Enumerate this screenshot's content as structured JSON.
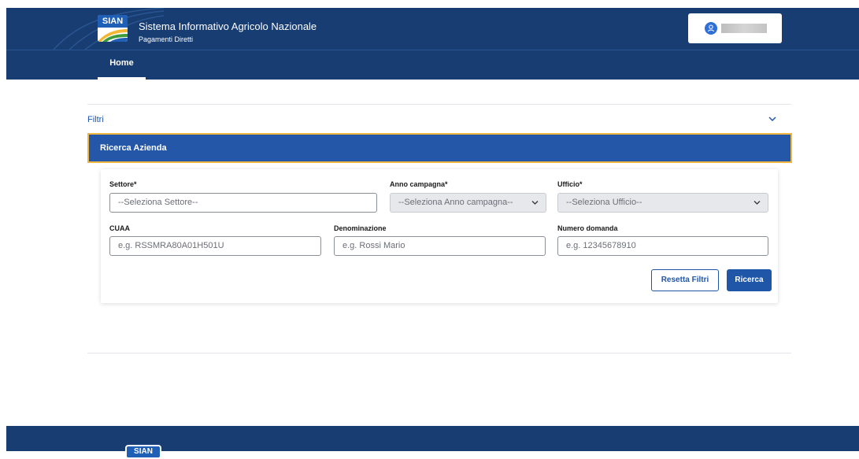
{
  "header": {
    "logo_text": "SIAN",
    "title": "Sistema Informativo Agricolo Nazionale",
    "subtitle": "Pagamenti Diretti",
    "brand_color": "#173d73"
  },
  "user_menu": {
    "icon": "user-icon"
  },
  "nav": {
    "home_label": "Home"
  },
  "filters": {
    "section_label": "Filtri",
    "ricerca_title": "Ricerca Azienda",
    "settore": {
      "label": "Settore*",
      "placeholder": "--Seleziona Settore--"
    },
    "anno_campagna": {
      "label": "Anno campagna*",
      "value": "--Seleziona Anno campagna--"
    },
    "ufficio": {
      "label": "Ufficio*",
      "value": "--Seleziona Ufficio--"
    },
    "cuaa": {
      "label": "CUAA",
      "placeholder": "e.g. RSSMRA80A01H501U"
    },
    "denominazione": {
      "label": "Denominazione",
      "placeholder": "e.g. Rossi Mario"
    },
    "numero_domanda": {
      "label": "Numero domanda",
      "placeholder": "e.g. 12345678910"
    },
    "reset_label": "Resetta Filtri",
    "search_label": "Ricerca"
  },
  "footer": {
    "logo_text": "SIAN"
  }
}
